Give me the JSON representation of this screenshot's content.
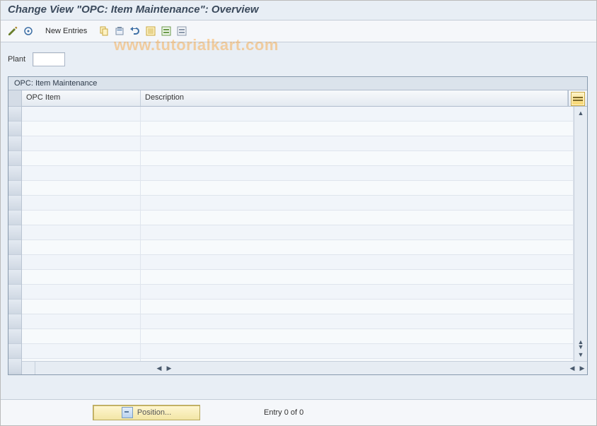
{
  "title": "Change View \"OPC: Item Maintenance\": Overview",
  "toolbar": {
    "new_entries_label": "New Entries"
  },
  "field": {
    "plant_label": "Plant",
    "plant_value": ""
  },
  "grid": {
    "caption": "OPC: Item Maintenance",
    "columns": {
      "c1": "OPC Item",
      "c2": "Description"
    },
    "row_count": 18
  },
  "footer": {
    "position_label": "Position...",
    "entry_text": "Entry 0 of 0"
  },
  "watermark": "www.tutorialkart.com"
}
